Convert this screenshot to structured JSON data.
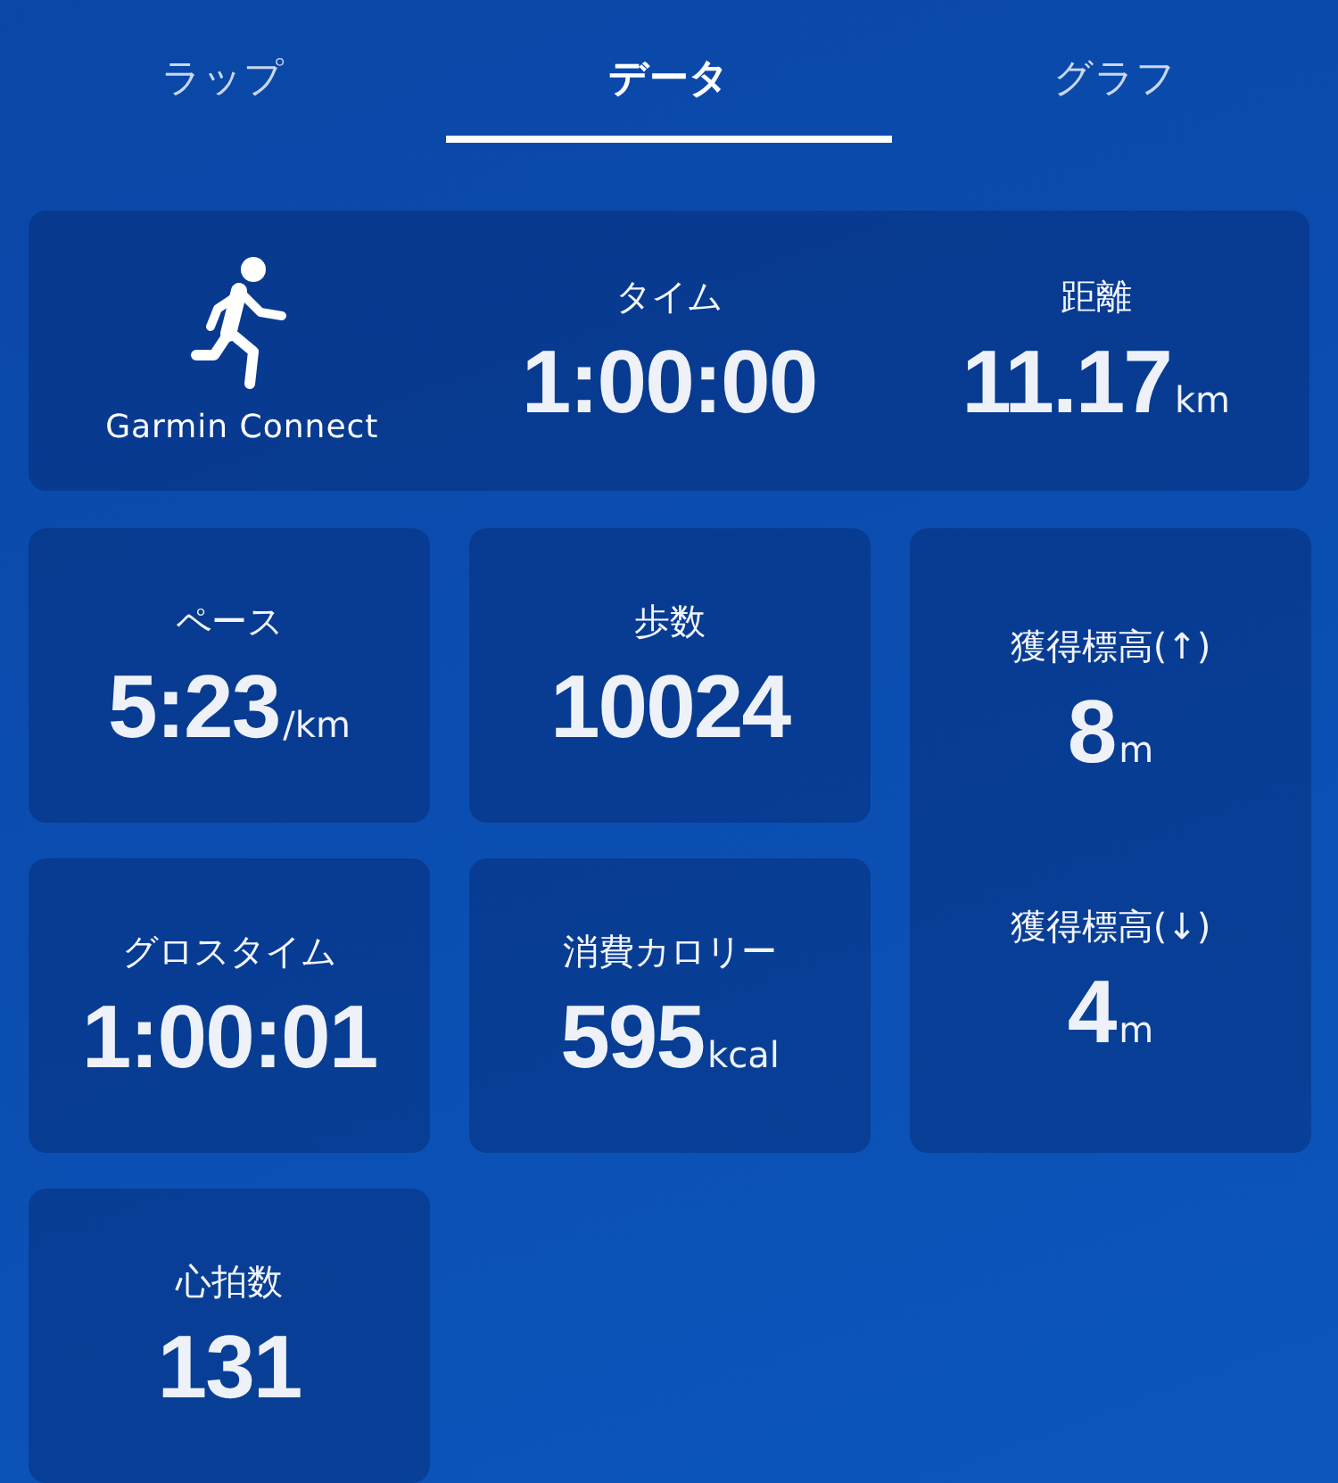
{
  "tabs": [
    {
      "label": "ラップ",
      "selected": false
    },
    {
      "label": "データ",
      "selected": true
    },
    {
      "label": "グラフ",
      "selected": false
    }
  ],
  "summary": {
    "source": "Garmin Connect",
    "metrics": [
      {
        "label": "タイム",
        "value": "1:00:00"
      },
      {
        "label": "距離",
        "value": "11.17",
        "unit": "km"
      }
    ]
  },
  "cards": [
    {
      "kind": "single",
      "metrics": [
        {
          "label": "ペース",
          "value": "5:23",
          "unit": "/km"
        }
      ]
    },
    {
      "kind": "single",
      "metrics": [
        {
          "label": "歩数",
          "value": "10024"
        }
      ]
    },
    {
      "kind": "stacked",
      "metrics": [
        {
          "label": "獲得標高(↑)",
          "value": "8",
          "unit": "m"
        },
        {
          "label": "獲得標高(↓)",
          "value": "4",
          "unit": "m"
        }
      ]
    },
    {
      "kind": "single",
      "metrics": [
        {
          "label": "グロスタイム",
          "value": "1:00:01"
        }
      ]
    },
    {
      "kind": "single",
      "metrics": [
        {
          "label": "消費カロリー",
          "value": "595",
          "unit": "kcal"
        }
      ]
    },
    {
      "kind": "single",
      "metrics": [
        {
          "label": "心拍数",
          "value": "131"
        }
      ]
    }
  ]
}
